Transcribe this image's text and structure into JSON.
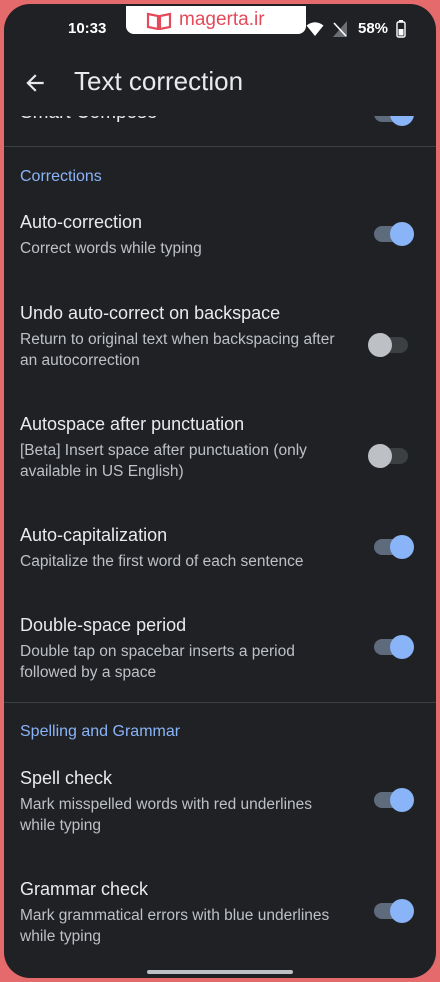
{
  "status_bar": {
    "time": "10:33",
    "battery_percent": "58%",
    "icons": [
      "wifi-icon",
      "no-signal-icon",
      "battery-icon"
    ]
  },
  "watermark": {
    "text": "magerta.ir",
    "color": "#e34a5a"
  },
  "app_bar": {
    "title": "Text correction",
    "back_icon": "arrow-back-icon"
  },
  "partial_item": {
    "label": "Smart Compose",
    "enabled": true
  },
  "sections": [
    {
      "header": "Corrections",
      "items": [
        {
          "title": "Auto-correction",
          "subtitle": "Correct words while typing",
          "enabled": true
        },
        {
          "title": "Undo auto-correct on backspace",
          "subtitle": "Return to original text when backspacing after an autocorrection",
          "enabled": false
        },
        {
          "title": "Autospace after punctuation",
          "subtitle": "[Beta] Insert space after punctuation (only available in US English)",
          "enabled": false
        },
        {
          "title": "Auto-capitalization",
          "subtitle": "Capitalize the first word of each sentence",
          "enabled": true
        },
        {
          "title": "Double-space period",
          "subtitle": "Double tap on spacebar inserts a period followed by a space",
          "enabled": true
        }
      ]
    },
    {
      "header": "Spelling and Grammar",
      "items": [
        {
          "title": "Spell check",
          "subtitle": "Mark misspelled words with red underlines while typing",
          "enabled": true
        },
        {
          "title": "Grammar check",
          "subtitle": "Mark grammatical errors with blue underlines while typing",
          "enabled": true
        }
      ]
    }
  ],
  "colors": {
    "background": "#202124",
    "accent": "#8ab4f8",
    "frame": "#e46a6c"
  }
}
